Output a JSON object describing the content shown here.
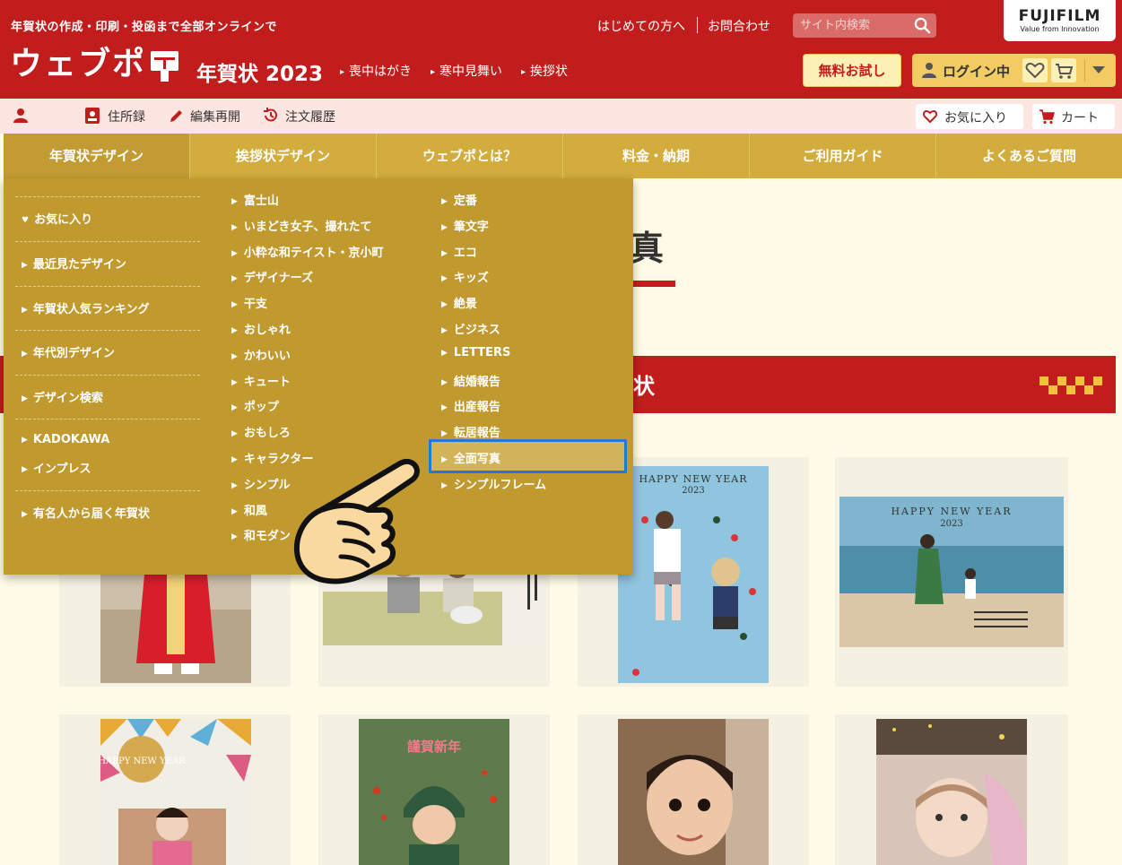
{
  "header": {
    "tagline": "年賀状の作成・印刷・投函まで全部オンラインで",
    "top_links": [
      "はじめての方へ",
      "お問合わせ"
    ],
    "search_placeholder": "サイト内検索",
    "brand": {
      "name": "FUJIFILM",
      "tagline": "Value from Innovation"
    },
    "logo": "ウェブポ",
    "logo_sub": "年賀状 2023",
    "nav": [
      "喪中はがき",
      "寒中見舞い",
      "挨拶状"
    ],
    "trial_button": "無料お試し",
    "login_label": "ログイン中"
  },
  "subbar": {
    "items": [
      "住所録",
      "編集再開",
      "注文履歴"
    ],
    "favorites": "お気に入り",
    "cart": "カート"
  },
  "main_nav": [
    "年賀状デザイン",
    "挨拶状デザイン",
    "ウェブポとは？",
    "料金・納期",
    "ご利用ガイド",
    "よくあるご質問"
  ],
  "mega_menu": {
    "left": {
      "favorite": "お気に入り",
      "items": [
        "最近見たデザイン",
        "年賀状人気ランキング",
        "年代別デザイン",
        "デザイン検索"
      ],
      "partners": [
        "KADOKAWA",
        "インプレス"
      ],
      "celebrity": "有名人から届く年賀状"
    },
    "middle": [
      "富士山",
      "いまどき女子、撮れたて",
      "小粋な和テイスト・京小町",
      "デザイナーズ",
      "干支",
      "おしゃれ",
      "かわいい",
      "キュート",
      "ポップ",
      "おもしろ",
      "キャラクター",
      "シンプル",
      "和風",
      "和モダン"
    ],
    "right": [
      "定番",
      "筆文字",
      "エコ",
      "キッズ",
      "絶景",
      "ビジネス",
      "LETTERS",
      "結婚報告",
      "出産報告",
      "転居報告",
      "全面写真",
      "シンプルフレーム"
    ],
    "highlighted": "全面写真"
  },
  "page": {
    "heading_fragment": "真",
    "banner_fragment": "状"
  },
  "cards": {
    "card3_text": "HAPPY NEW YEAR",
    "card3_year": "2023",
    "card4_text": "HAPPY NEW YEAR",
    "card4_year": "2023",
    "card5_text": "HAPPY NEW YEAR",
    "card6_text": "謹賀新年"
  },
  "colors": {
    "header_red": "#c11d1c",
    "nav_gold": "#d2ac3d",
    "menu_gold": "#c0992f",
    "highlight_blue": "#1e7ad8"
  }
}
